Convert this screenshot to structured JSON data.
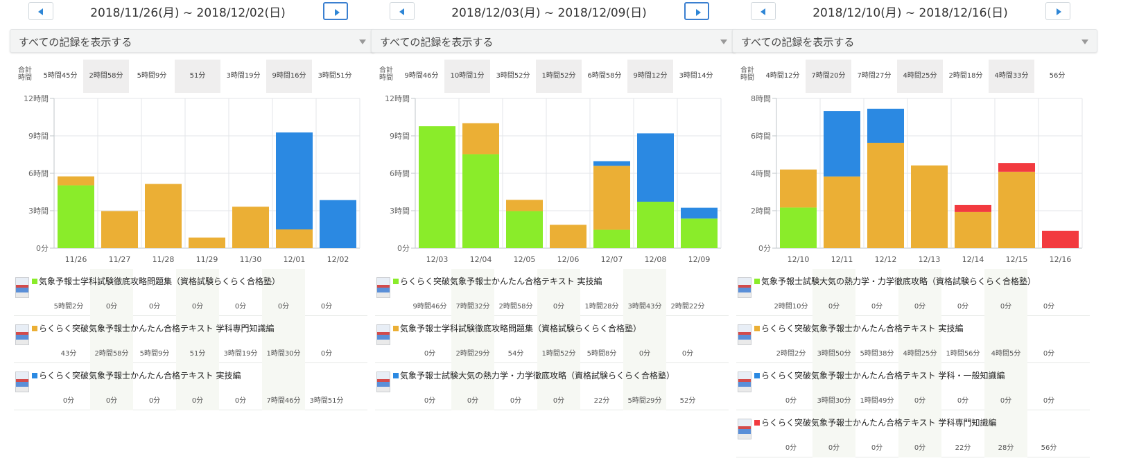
{
  "colors": {
    "green": "#8aec2a",
    "orange": "#ebaf35",
    "blue": "#2b89e2",
    "red": "#f23a3f"
  },
  "filter_label": "すべての記録を表示する",
  "totals_label_line1": "合計",
  "totals_label_line2": "時間",
  "weeks": [
    {
      "week_label": "2018/11/26(月) ~ 2018/12/02(日)",
      "next_active": true,
      "totals": [
        "5時間45分",
        "2時間58分",
        "5時間9分",
        "51分",
        "3時間19分",
        "9時間16分",
        "3時間51分"
      ],
      "books": [
        {
          "title": "気象予報士学科試験徹底攻略問題集（資格試験らくらく合格塾）",
          "color": "#8aec2a",
          "times": [
            "5時間2分",
            "0分",
            "0分",
            "0分",
            "0分",
            "0分",
            "0分"
          ]
        },
        {
          "title": "らくらく突破気象予報士かんたん合格テキスト 学科専門知識編",
          "color": "#ebaf35",
          "times": [
            "43分",
            "2時間58分",
            "5時間9分",
            "51分",
            "3時間19分",
            "1時間30分",
            "0分"
          ]
        },
        {
          "title": "らくらく突破気象予報士かんたん合格テキスト 実技編",
          "color": "#2b89e2",
          "times": [
            "0分",
            "0分",
            "0分",
            "0分",
            "0分",
            "7時間46分",
            "3時間51分"
          ]
        }
      ]
    },
    {
      "week_label": "2018/12/03(月) ~ 2018/12/09(日)",
      "next_active": true,
      "totals": [
        "9時間46分",
        "10時間1分",
        "3時間52分",
        "1時間52分",
        "6時間58分",
        "9時間12分",
        "3時間14分"
      ],
      "books": [
        {
          "title": "らくらく突破気象予報士かんたん合格テキスト 実技編",
          "color": "#8aec2a",
          "times": [
            "9時間46分",
            "7時間32分",
            "2時間58分",
            "0分",
            "1時間28分",
            "3時間43分",
            "2時間22分"
          ]
        },
        {
          "title": "気象予報士学科試験徹底攻略問題集（資格試験らくらく合格塾）",
          "color": "#ebaf35",
          "times": [
            "0分",
            "2時間29分",
            "54分",
            "1時間52分",
            "5時間8分",
            "0分",
            "0分"
          ]
        },
        {
          "title": "気象予報士試験大気の熱力学・力学徹底攻略（資格試験らくらく合格塾）",
          "color": "#2b89e2",
          "times": [
            "0分",
            "0分",
            "0分",
            "0分",
            "22分",
            "5時間29分",
            "52分"
          ]
        }
      ]
    },
    {
      "week_label": "2018/12/10(月) ~ 2018/12/16(日)",
      "next_active": false,
      "totals": [
        "4時間12分",
        "7時間20分",
        "7時間27分",
        "4時間25分",
        "2時間18分",
        "4時間33分",
        "56分"
      ],
      "books": [
        {
          "title": "気象予報士試験大気の熱力学・力学徹底攻略（資格試験らくらく合格塾）",
          "color": "#8aec2a",
          "times": [
            "2時間10分",
            "0分",
            "0分",
            "0分",
            "0分",
            "0分",
            "0分"
          ]
        },
        {
          "title": "らくらく突破気象予報士かんたん合格テキスト 実技編",
          "color": "#ebaf35",
          "times": [
            "2時間2分",
            "3時間50分",
            "5時間38分",
            "4時間25分",
            "1時間56分",
            "4時間5分",
            "0分"
          ]
        },
        {
          "title": "らくらく突破気象予報士かんたん合格テキスト 学科・一般知識編",
          "color": "#2b89e2",
          "times": [
            "0分",
            "3時間30分",
            "1時間49分",
            "0分",
            "0分",
            "0分",
            "0分"
          ]
        },
        {
          "title": "らくらく突破気象予報士かんたん合格テキスト 学科専門知識編",
          "color": "#f23a3f",
          "times": [
            "0分",
            "0分",
            "0分",
            "0分",
            "22分",
            "28分",
            "56分"
          ]
        }
      ]
    }
  ],
  "chart_data": [
    {
      "type": "bar",
      "stacked": true,
      "categories": [
        "11/26",
        "11/27",
        "11/28",
        "11/29",
        "11/30",
        "12/01",
        "12/02"
      ],
      "y_ticks": [
        "0分",
        "3時間",
        "6時間",
        "9時間",
        "12時間"
      ],
      "ylim": [
        0,
        12
      ],
      "grid": true,
      "series": [
        {
          "name": "気象予報士学科試験徹底攻略問題集（資格試験らくらく合格塾）",
          "color": "#8aec2a",
          "values": [
            5.03,
            0,
            0,
            0,
            0,
            0,
            0
          ]
        },
        {
          "name": "らくらく突破気象予報士かんたん合格テキスト 学科専門知識編",
          "color": "#ebaf35",
          "values": [
            0.72,
            2.97,
            5.15,
            0.85,
            3.32,
            1.5,
            0
          ]
        },
        {
          "name": "らくらく突破気象予報士かんたん合格テキスト 実技編",
          "color": "#2b89e2",
          "values": [
            0,
            0,
            0,
            0,
            0,
            7.77,
            3.85
          ]
        }
      ]
    },
    {
      "type": "bar",
      "stacked": true,
      "categories": [
        "12/03",
        "12/04",
        "12/05",
        "12/06",
        "12/07",
        "12/08",
        "12/09"
      ],
      "y_ticks": [
        "0分",
        "3時間",
        "6時間",
        "9時間",
        "12時間"
      ],
      "ylim": [
        0,
        12
      ],
      "grid": true,
      "series": [
        {
          "name": "らくらく突破気象予報士かんたん合格テキスト 実技編",
          "color": "#8aec2a",
          "values": [
            9.77,
            7.53,
            2.97,
            0,
            1.47,
            3.72,
            2.37
          ]
        },
        {
          "name": "気象予報士学科試験徹底攻略問題集（資格試験らくらく合格塾）",
          "color": "#ebaf35",
          "values": [
            0,
            2.48,
            0.9,
            1.87,
            5.13,
            0,
            0
          ]
        },
        {
          "name": "気象予報士試験大気の熱力学・力学徹底攻略（資格試験らくらく合格塾）",
          "color": "#2b89e2",
          "values": [
            0,
            0,
            0,
            0,
            0.37,
            5.48,
            0.87
          ]
        }
      ]
    },
    {
      "type": "bar",
      "stacked": true,
      "categories": [
        "12/10",
        "12/11",
        "12/12",
        "12/13",
        "12/14",
        "12/15",
        "12/16"
      ],
      "y_ticks": [
        "0分",
        "2時間",
        "4時間",
        "6時間",
        "8時間"
      ],
      "ylim": [
        0,
        8
      ],
      "grid": true,
      "series": [
        {
          "name": "気象予報士試験大気の熱力学・力学徹底攻略（資格試験らくらく合格塾）",
          "color": "#8aec2a",
          "values": [
            2.17,
            0,
            0,
            0,
            0,
            0,
            0
          ]
        },
        {
          "name": "らくらく突破気象予報士かんたん合格テキスト 実技編",
          "color": "#ebaf35",
          "values": [
            2.03,
            3.83,
            5.63,
            4.42,
            1.93,
            4.08,
            0
          ]
        },
        {
          "name": "らくらく突破気象予報士かんたん合格テキスト 学科・一般知識編",
          "color": "#2b89e2",
          "values": [
            0,
            3.5,
            1.82,
            0,
            0,
            0,
            0
          ]
        },
        {
          "name": "らくらく突破気象予報士かんたん合格テキスト 学科専門知識編",
          "color": "#f23a3f",
          "values": [
            0,
            0,
            0,
            0,
            0.37,
            0.47,
            0.93
          ]
        }
      ]
    }
  ]
}
